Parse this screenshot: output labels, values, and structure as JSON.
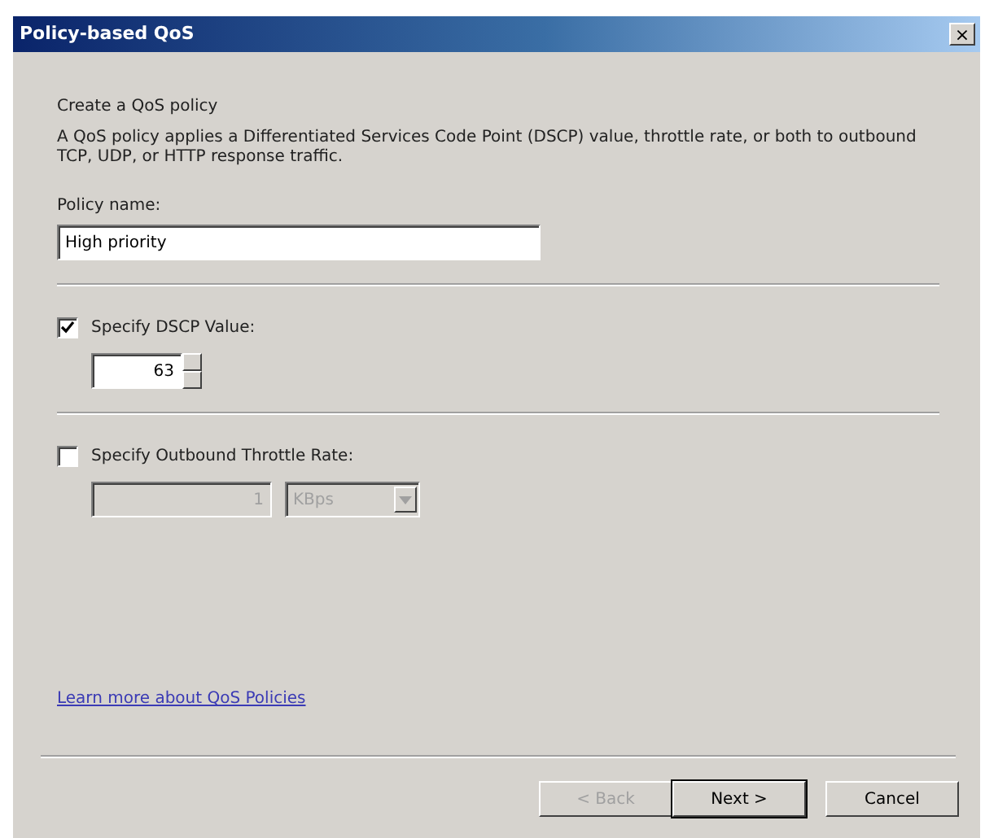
{
  "window": {
    "title": "Policy-based QoS",
    "close": "×"
  },
  "heading": "Create a QoS policy",
  "description": "A QoS policy applies a Differentiated Services Code Point (DSCP) value, throttle rate, or both to outbound TCP, UDP, or HTTP response traffic.",
  "policy_name": {
    "label": "Policy name:",
    "value": "High priority"
  },
  "dscp": {
    "label": "Specify DSCP Value:",
    "checked": true,
    "value": "63"
  },
  "throttle": {
    "label": "Specify Outbound Throttle Rate:",
    "checked": false,
    "value": "1",
    "unit": "KBps"
  },
  "link": "Learn more about QoS Policies",
  "buttons": [
    {
      "label": "< Back",
      "disabled": true,
      "default": false
    },
    {
      "label": "Next >",
      "disabled": false,
      "default": true
    },
    {
      "label": "Cancel",
      "disabled": false,
      "default": false
    }
  ]
}
